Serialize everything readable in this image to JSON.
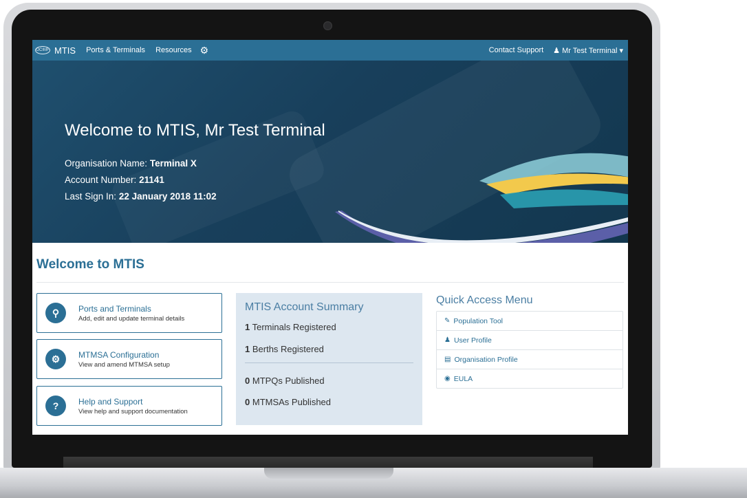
{
  "navbar": {
    "brand_logo_text": "OCIMF",
    "brand": "MTIS",
    "links": [
      "Ports & Terminals",
      "Resources"
    ],
    "contact_support": "Contact Support",
    "user_menu": "Mr Test Terminal"
  },
  "hero": {
    "title": "Welcome to MTIS, Mr Test Terminal",
    "org_label": "Organisation Name:",
    "org_value": "Terminal X",
    "account_label": "Account Number:",
    "account_value": "21141",
    "signin_label": "Last Sign In:",
    "signin_value": "22 January 2018 11:02"
  },
  "main": {
    "section_title": "Welcome to MTIS",
    "cards": [
      {
        "icon": "map-marker-icon",
        "glyph": "⚲",
        "title": "Ports and Terminals",
        "desc": "Add, edit and update terminal details"
      },
      {
        "icon": "cogs-icon",
        "glyph": "⚙",
        "title": "MTMSA Configuration",
        "desc": "View and amend MTMSA setup"
      },
      {
        "icon": "question-icon",
        "glyph": "?",
        "title": "Help and Support",
        "desc": "View help and support documentation"
      }
    ]
  },
  "summary": {
    "title": "MTIS Account Summary",
    "rows": [
      {
        "count": "1",
        "label": "Terminals Registered"
      },
      {
        "count": "1",
        "label": "Berths Registered"
      },
      {
        "count": "0",
        "label": "MTPQs Published"
      },
      {
        "count": "0",
        "label": "MTMSAs Published"
      }
    ]
  },
  "quick_access": {
    "title": "Quick Access Menu",
    "items": [
      {
        "icon": "wand-icon",
        "glyph": "✎",
        "label": "Population Tool"
      },
      {
        "icon": "user-icon",
        "glyph": "♟",
        "label": "User Profile"
      },
      {
        "icon": "building-icon",
        "glyph": "▤",
        "label": "Organisation Profile"
      },
      {
        "icon": "eye-icon",
        "glyph": "◉",
        "label": "EULA"
      }
    ]
  },
  "colors": {
    "primary": "#2b6f95",
    "hero_bg": "#1a4663",
    "summary_bg": "#dde7f0"
  }
}
